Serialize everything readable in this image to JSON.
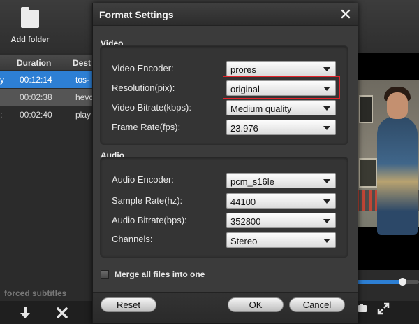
{
  "toolbar": {
    "add_folder_label": "Add folder"
  },
  "file_list": {
    "columns": {
      "duration": "Duration",
      "destination": "Dest"
    },
    "rows": [
      {
        "lead": "y",
        "duration": "00:12:14",
        "destination": "tos-"
      },
      {
        "lead": "",
        "duration": "00:02:38",
        "destination": "hevc"
      },
      {
        "lead": ":",
        "duration": "00:02:40",
        "destination": "play"
      }
    ],
    "forced_subtitles_label": "forced subtitles"
  },
  "preview": {
    "seek_progress": 0.76
  },
  "dialog": {
    "title": "Format Settings",
    "video": {
      "group_label": "Video",
      "encoder_label": "Video Encoder:",
      "encoder_value": "prores",
      "resolution_label": "Resolution(pix):",
      "resolution_value": "original",
      "bitrate_label": "Video Bitrate(kbps):",
      "bitrate_value": "Medium quality",
      "framerate_label": "Frame Rate(fps):",
      "framerate_value": "23.976"
    },
    "audio": {
      "group_label": "Audio",
      "encoder_label": "Audio Encoder:",
      "encoder_value": "pcm_s16le",
      "samplerate_label": "Sample Rate(hz):",
      "samplerate_value": "44100",
      "bitrate_label": "Audio Bitrate(bps):",
      "bitrate_value": "352800",
      "channels_label": "Channels:",
      "channels_value": "Stereo"
    },
    "merge_label": "Merge all files into one",
    "merge_checked": false,
    "buttons": {
      "reset": "Reset",
      "ok": "OK",
      "cancel": "Cancel"
    },
    "highlight_color": "#e3242b"
  },
  "colors": {
    "accent": "#2d7fd4",
    "background": "#2b2b2b",
    "dialog": "#3b3b3b"
  }
}
